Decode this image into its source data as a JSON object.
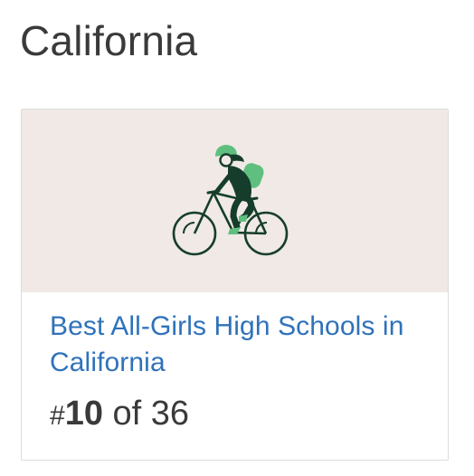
{
  "section": {
    "title": "California"
  },
  "card": {
    "illustration_icon": "cyclist-with-backpack-icon",
    "colors": {
      "hero_background": "#f0e9e5",
      "illustration_dark": "#163d2c",
      "illustration_accent": "#5fbf7f",
      "link": "#2f72ba"
    },
    "ranking_title": "Best All-Girls High Schools in California",
    "rank": {
      "hash": "#",
      "number": "10",
      "of_text": " of 36"
    }
  }
}
